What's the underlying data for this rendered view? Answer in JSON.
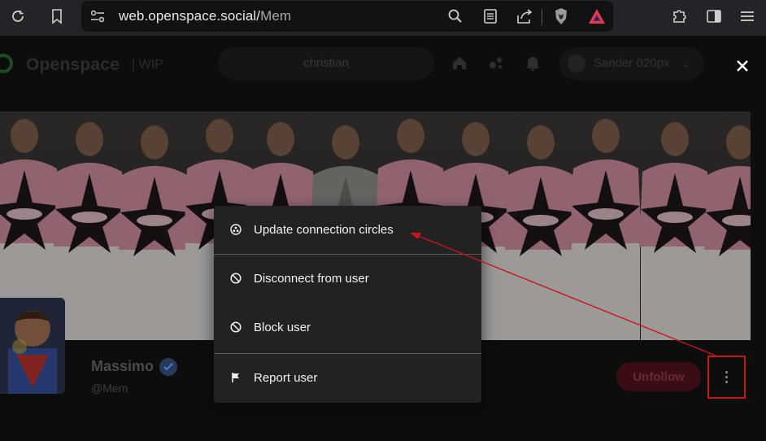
{
  "browser": {
    "url_host": "web.openspace.social/",
    "url_path": "Mem",
    "icons": [
      "reload-icon",
      "bookmark-icon",
      "site-settings-icon",
      "zoom-icon",
      "reader-icon",
      "share-icon",
      "brave-shield-icon",
      "brave-rewards-icon",
      "extensions-icon",
      "sidebar-icon",
      "menu-icon"
    ]
  },
  "app": {
    "logo_text": "Openspace",
    "logo_suffix": "| WIP",
    "search_value": "christian",
    "user_name": "Sander 020px",
    "brand_color": "#1e4a24"
  },
  "profile": {
    "name": "Massimo",
    "handle": "@Mem",
    "unfollow_label": "Unfollow"
  },
  "menu": {
    "items": [
      {
        "label": "Update connection circles",
        "icon": "circles-icon"
      },
      {
        "label": "Disconnect from user",
        "icon": "block-circle-icon"
      },
      {
        "label": "Block user",
        "icon": "block-circle-icon"
      },
      {
        "label": "Report user",
        "icon": "flag-icon"
      }
    ]
  },
  "annotation": {
    "highlight_color": "#c4161c"
  }
}
